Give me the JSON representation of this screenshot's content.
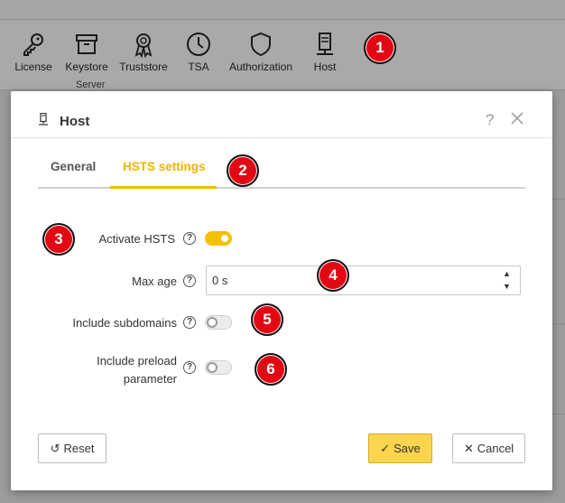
{
  "ribbon": {
    "items": [
      {
        "label": "License",
        "icon": "key-icon"
      },
      {
        "label": "Keystore",
        "icon": "archive-box-icon"
      },
      {
        "label": "Truststore",
        "icon": "award-ribbon-icon"
      },
      {
        "label": "TSA",
        "icon": "clock-icon"
      },
      {
        "label": "Authorization",
        "icon": "shield-icon"
      },
      {
        "label": "Host",
        "icon": "server-host-icon"
      }
    ],
    "group_label": "Server"
  },
  "markers": [
    "1",
    "2",
    "3",
    "4",
    "5",
    "6"
  ],
  "dialog": {
    "title": "Host",
    "help": "?",
    "tabs": [
      {
        "label": "General",
        "active": false
      },
      {
        "label": "HSTS settings",
        "active": true
      }
    ],
    "fields": {
      "activate_hsts": {
        "label": "Activate HSTS",
        "on": true
      },
      "max_age": {
        "label": "Max age",
        "value": "0 s"
      },
      "include_subdomains": {
        "label": "Include subdomains",
        "on": false
      },
      "include_preload": {
        "label_line1": "Include preload",
        "label_line2": "parameter",
        "on": false
      }
    },
    "buttons": {
      "reset": "Reset",
      "save": "Save",
      "cancel": "Cancel"
    }
  },
  "colors": {
    "accent": "#f0b400",
    "marker": "#e30613",
    "save_bg": "#fbd54d"
  }
}
